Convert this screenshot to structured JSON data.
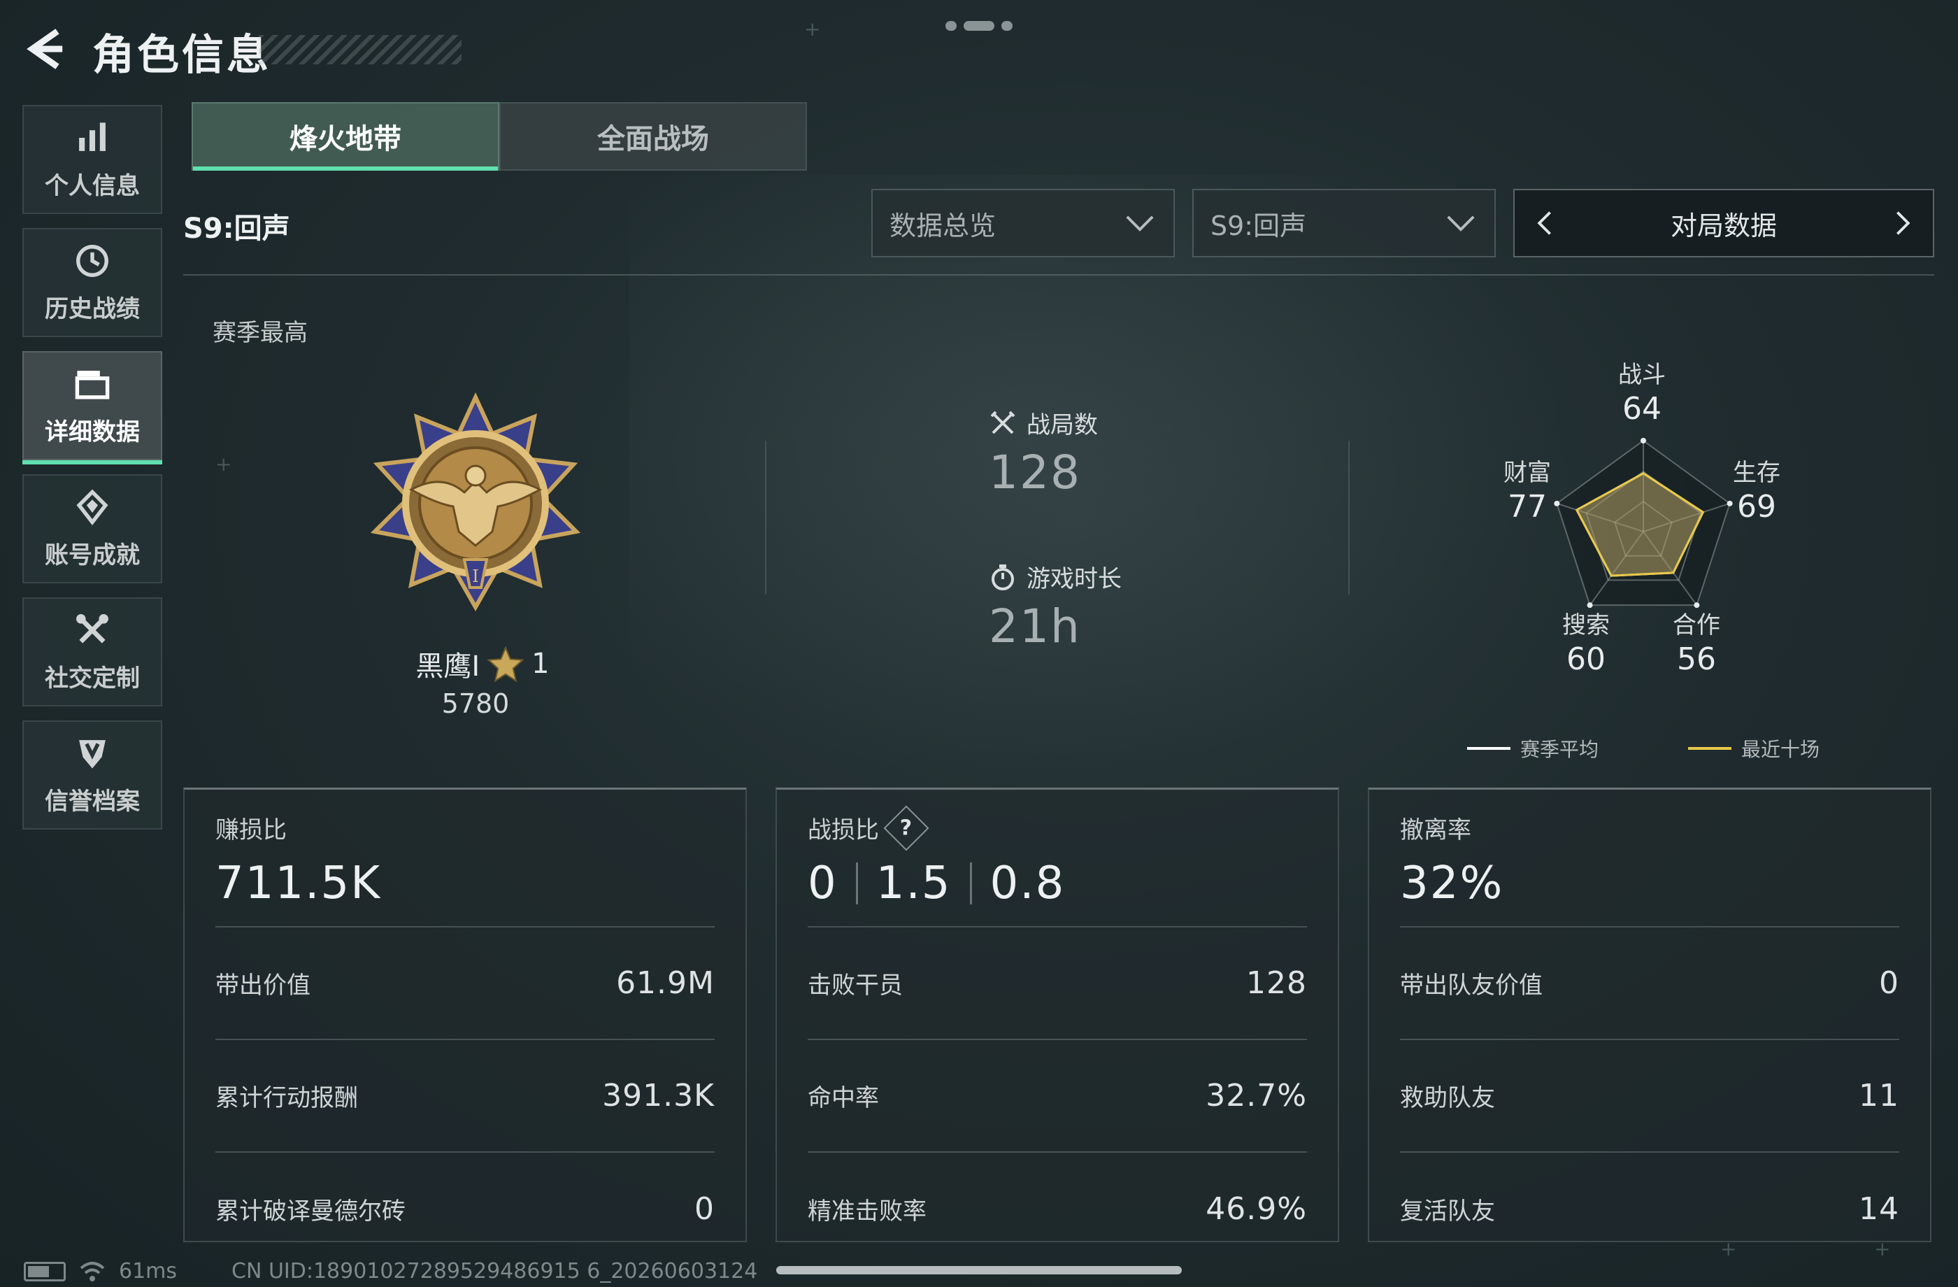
{
  "header": {
    "title": "角色信息",
    "back_icon": "back-arrow-icon"
  },
  "sidebar": {
    "items": [
      {
        "label": "个人信息",
        "icon": "bar-chart-icon",
        "active": false
      },
      {
        "label": "历史战绩",
        "icon": "history-clock-icon",
        "active": false
      },
      {
        "label": "详细数据",
        "icon": "folder-icon",
        "active": true
      },
      {
        "label": "账号成就",
        "icon": "achievement-icon",
        "active": false
      },
      {
        "label": "社交定制",
        "icon": "tools-icon",
        "active": false
      },
      {
        "label": "信誉档案",
        "icon": "shield-icon",
        "active": false
      }
    ]
  },
  "tabs": [
    {
      "label": "烽火地带",
      "active": true
    },
    {
      "label": "全面战场",
      "active": false
    }
  ],
  "season_label": "S9:回声",
  "filters": {
    "overview_value": "数据总览",
    "season_value": "S9:回声",
    "pager_value": "对局数据"
  },
  "season_best": {
    "title": "赛季最高",
    "rank_name": "黑鹰I",
    "rank_level": "1",
    "points": "5780"
  },
  "summary": {
    "matches_label": "战局数",
    "matches_value": "128",
    "playtime_label": "游戏时长",
    "playtime_value": "21h"
  },
  "radar": {
    "axes": [
      {
        "name": "战斗",
        "value": 64
      },
      {
        "name": "生存",
        "value": 69
      },
      {
        "name": "合作",
        "value": 56
      },
      {
        "name": "搜索",
        "value": 60
      },
      {
        "name": "财富",
        "value": 77
      }
    ],
    "labels": {
      "combat": {
        "name": "战斗",
        "value": "64"
      },
      "survival": {
        "name": "生存",
        "value": "69"
      },
      "coop": {
        "name": "合作",
        "value": "56"
      },
      "search": {
        "name": "搜索",
        "value": "60"
      },
      "wealth": {
        "name": "财富",
        "value": "77"
      }
    },
    "legend": [
      {
        "label": "赛季平均",
        "color": "#ffffff"
      },
      {
        "label": "最近十场",
        "color": "#e8c84a"
      }
    ]
  },
  "cards": {
    "profit": {
      "title": "赚损比",
      "value": "711.5K",
      "rows": [
        {
          "k": "带出价值",
          "v": "61.9M"
        },
        {
          "k": "累计行动报酬",
          "v": "391.3K"
        },
        {
          "k": "累计破译曼德尔砖",
          "v": "0"
        }
      ]
    },
    "combat": {
      "title": "战损比",
      "help_icon": "?",
      "values": [
        "0",
        "1.5",
        "0.8"
      ],
      "rows": [
        {
          "k": "击败干员",
          "v": "128"
        },
        {
          "k": "命中率",
          "v": "32.7%"
        },
        {
          "k": "精准击败率",
          "v": "46.9%"
        }
      ]
    },
    "extract": {
      "title": "撤离率",
      "value": "32%",
      "rows": [
        {
          "k": "带出队友价值",
          "v": "0"
        },
        {
          "k": "救助队友",
          "v": "11"
        },
        {
          "k": "复活队友",
          "v": "14"
        }
      ]
    }
  },
  "status_bar": {
    "ping": "61ms",
    "uid": "CN UID:18901027289529486915 6_20260603124"
  },
  "colors": {
    "accent": "#5fe0ae",
    "recent_line": "#e8c84a"
  }
}
